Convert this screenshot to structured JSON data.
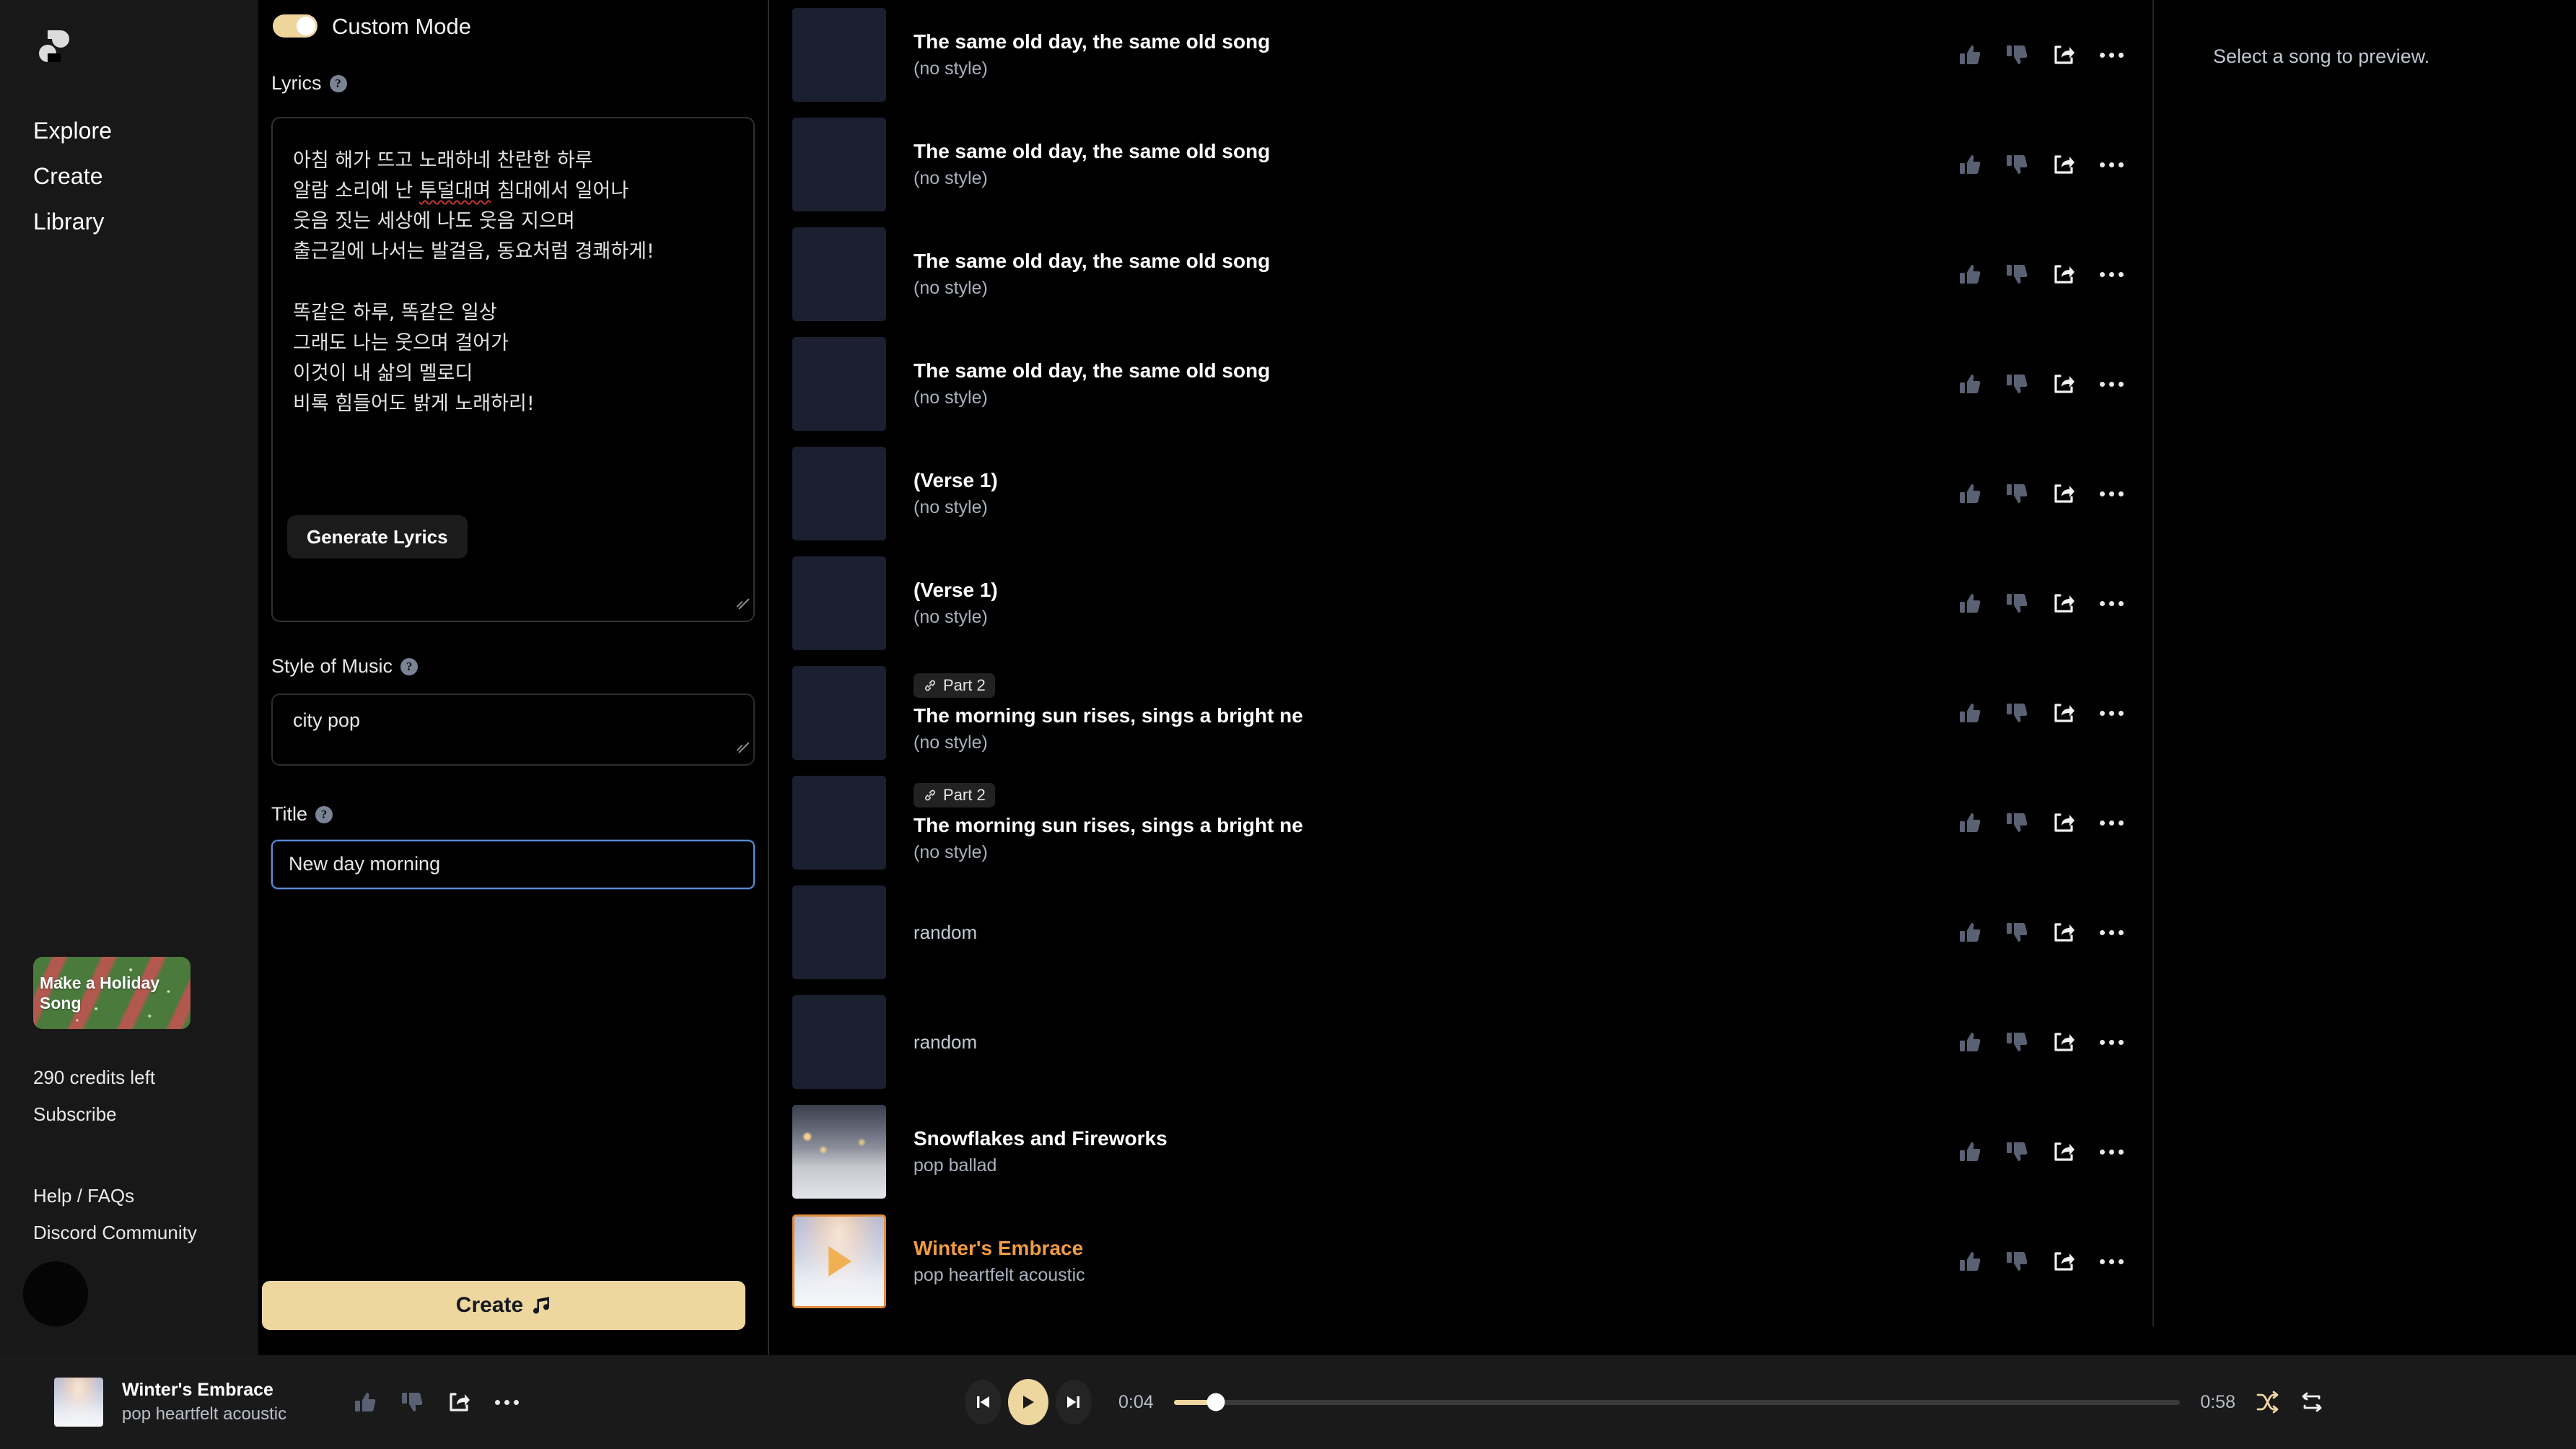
{
  "brand": {
    "logo_icon": "suno-wave-logo"
  },
  "sidebar": {
    "links": [
      {
        "label": "Explore",
        "icon": "compass-icon"
      },
      {
        "label": "Create",
        "icon": "plus-icon"
      },
      {
        "label": "Library",
        "icon": "library-icon"
      }
    ],
    "holiday_banner": {
      "label": "Make a Holiday Song"
    },
    "credits_label": "290 credits left",
    "subscribe_label": "Subscribe",
    "help_label": "Help / FAQs",
    "discord_label": "Discord Community",
    "avatar_icon": "user-avatar"
  },
  "form": {
    "custom_mode": {
      "label": "Custom Mode",
      "enabled": true,
      "accent": "#edd59c"
    },
    "lyrics": {
      "label": "Lyrics",
      "help_icon": "question-mark-icon",
      "line1": "아침 해가 뜨고 노래하네 찬란한 하루",
      "line2_a": "알람 소리에 난 ",
      "line2_misspelled": "투덜대며",
      "line2_b": " 침대에서 일어나",
      "line3": "웃음 짓는 세상에 나도 웃음 지으며",
      "line4": "출근길에 나서는 발걸음, 동요처럼 경쾌하게!",
      "line5": "똑같은 하루, 똑같은 일상",
      "line6": "그래도 나는 웃으며 걸어가",
      "line7": "이것이 내 삶의 멜로디",
      "line8": "비록 힘들어도 밝게 노래하리!",
      "generate_button": "Generate Lyrics"
    },
    "style_of_music": {
      "label": "Style of Music",
      "value": "city pop",
      "help_icon": "question-mark-icon"
    },
    "title": {
      "label": "Title",
      "value": "New day morning",
      "help_icon": "question-mark-icon",
      "focus_color": "#5b8dd9"
    },
    "create_button": {
      "label": "Create",
      "icon": "music-note-icon",
      "color": "#eed69f"
    }
  },
  "songs": [
    {
      "title": "The same old day, the same old song",
      "style": "(no style)",
      "thumb": "placeholder",
      "badge": null,
      "active": false
    },
    {
      "title": "The same old day, the same old song",
      "style": "(no style)",
      "thumb": "placeholder",
      "badge": null,
      "active": false
    },
    {
      "title": "The same old day, the same old song",
      "style": "(no style)",
      "thumb": "placeholder",
      "badge": null,
      "active": false
    },
    {
      "title": "The same old day, the same old song",
      "style": "(no style)",
      "thumb": "placeholder",
      "badge": null,
      "active": false
    },
    {
      "title": "(Verse 1)",
      "style": "(no style)",
      "thumb": "placeholder",
      "badge": null,
      "active": false
    },
    {
      "title": "(Verse 1)",
      "style": "(no style)",
      "thumb": "placeholder",
      "badge": null,
      "active": false
    },
    {
      "title": "The morning sun rises, sings a bright ne",
      "style": "(no style)",
      "thumb": "placeholder",
      "badge": "Part 2",
      "badge_icon": "link-icon",
      "active": false
    },
    {
      "title": "The morning sun rises, sings a bright ne",
      "style": "(no style)",
      "thumb": "placeholder",
      "badge": "Part 2",
      "badge_icon": "link-icon",
      "active": false
    },
    {
      "title": null,
      "style": "random",
      "thumb": "placeholder",
      "badge": null,
      "active": false
    },
    {
      "title": null,
      "style": "random",
      "thumb": "placeholder",
      "badge": null,
      "active": false
    },
    {
      "title": "Snowflakes and Fireworks",
      "style": "pop ballad",
      "thumb": "snow-street-night",
      "badge": null,
      "active": false
    },
    {
      "title": "Winter's Embrace",
      "style": "pop heartfelt acoustic",
      "thumb": "snow-sunset-path",
      "badge": null,
      "active": true,
      "accent": "#ef9c44"
    }
  ],
  "row_actions": {
    "thumbs_up_icon": "thumbs-up-icon",
    "thumbs_down_icon": "thumbs-down-icon",
    "share_icon": "share-icon",
    "more_icon": "more-options-icon"
  },
  "preview": {
    "empty_message": "Select a song to preview."
  },
  "player": {
    "now_playing_title": "Winter's Embrace",
    "now_playing_style": "pop heartfelt acoustic",
    "prev_icon": "skip-previous-icon",
    "play_icon": "play-icon",
    "next_icon": "skip-next-icon",
    "current_time": "0:04",
    "total_time": "0:58",
    "progress_percent": 4.2,
    "shuffle_icon": "shuffle-icon",
    "repeat_icon": "repeat-icon",
    "shuffle_active": true,
    "accent": "#eed69f"
  }
}
